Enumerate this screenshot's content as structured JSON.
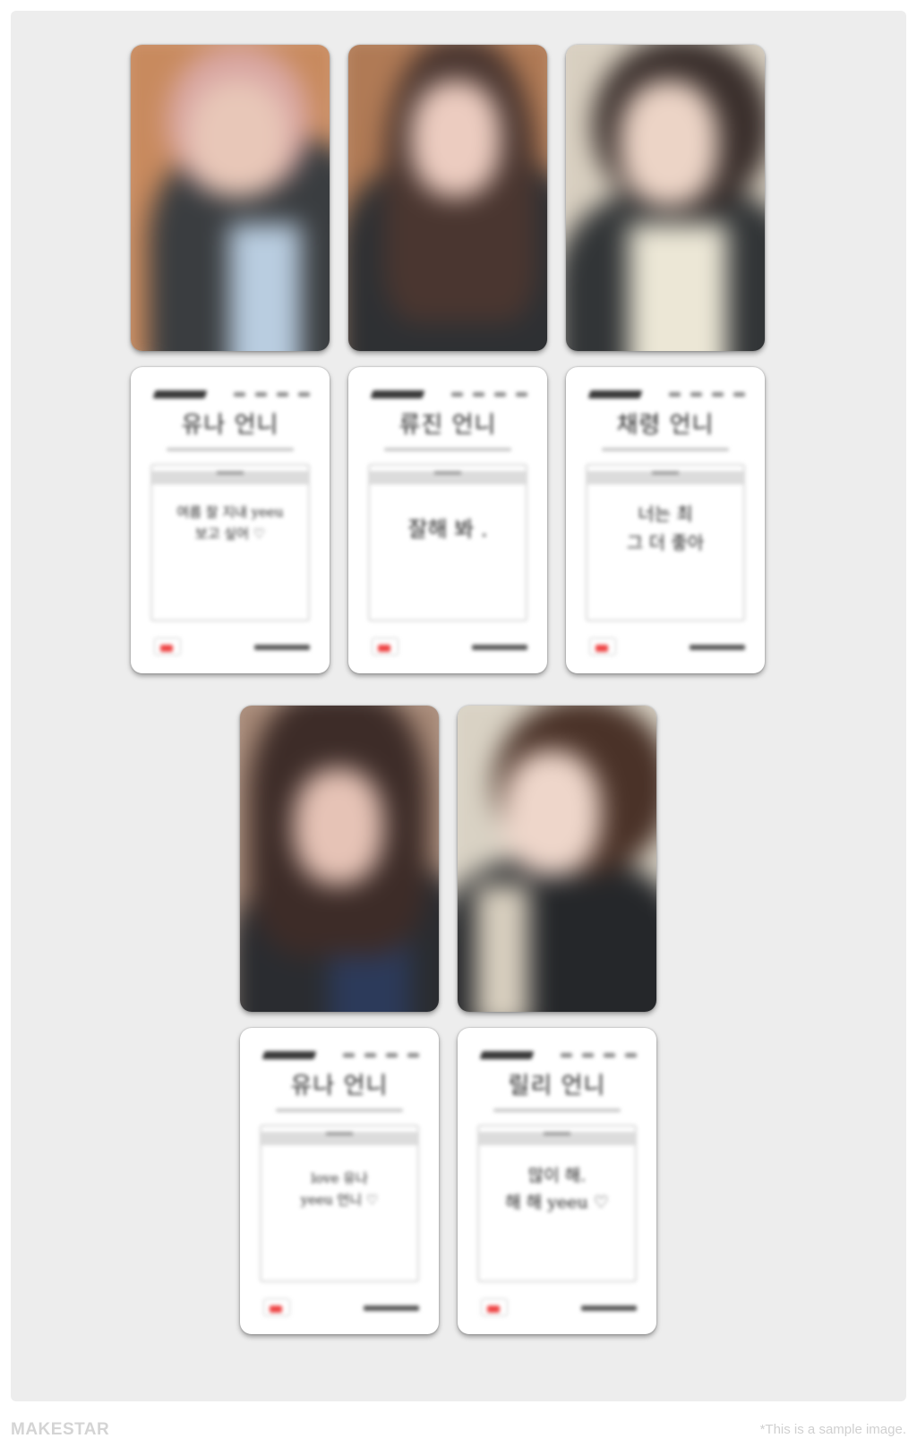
{
  "footer": {
    "brand": "MAKESTAR",
    "note": "*This is a sample image."
  },
  "cards": [
    {
      "front_colors": {
        "bg": "#c88a5e",
        "hair": "#d9a7a3",
        "skin": "#e8c7b8",
        "jacket": "#3a3d40",
        "shirt": "#b9cde0"
      },
      "back_title": "유나 언니",
      "back_message": [
        "여름 잘 지내 yeeu",
        "보고 싶어 ♡"
      ]
    },
    {
      "front_colors": {
        "bg": "#b07a55",
        "hair": "#4a3630",
        "skin": "#ecccc0",
        "jacket": "#2e3033",
        "shirt": "#3a3030"
      },
      "back_title": "류진 언니",
      "back_message": [
        "잘해 봐 ."
      ]
    },
    {
      "front_colors": {
        "bg": "#d8cfc0",
        "hair": "#3a2f2c",
        "skin": "#ecd4c6",
        "jacket": "#323537",
        "shirt": "#ece7d6"
      },
      "back_title": "채령 언니",
      "back_message": [
        "너는 최",
        "그 더 좋아"
      ]
    },
    {
      "front_colors": {
        "bg": "#a88a78",
        "hair": "#3d2c28",
        "skin": "#e6c3b6",
        "jacket": "#2a2c30",
        "shirt": "#2c3a5a"
      },
      "back_title": "유나 언니",
      "back_message": [
        "love 유나",
        "yeeu 언니 ♡"
      ]
    },
    {
      "front_colors": {
        "bg": "#d9d2c4",
        "hair": "#4a3228",
        "skin": "#eed6ca",
        "jacket": "#25272a",
        "shirt": "#d8cbbf"
      },
      "back_title": "릴리 언니",
      "back_message": [
        "많이 해.",
        "해 해 yeeu ♡"
      ]
    }
  ]
}
